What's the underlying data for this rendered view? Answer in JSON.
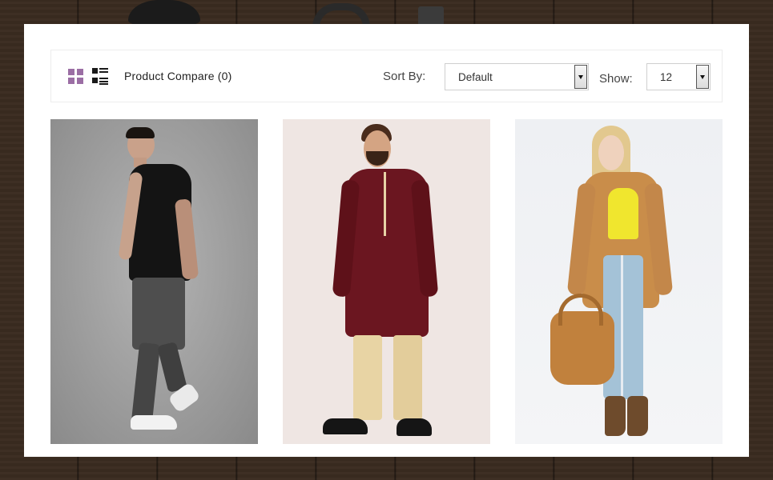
{
  "toolbar": {
    "compare_label": "Product Compare (0)",
    "sort_label": "Sort By:",
    "sort_value": "Default",
    "show_label": "Show:",
    "show_value": "12",
    "grid_icon": "grid-view-icon",
    "list_icon": "list-view-icon"
  },
  "products": [
    {
      "image": "man in black polo and grey jeans"
    },
    {
      "image": "man in maroon kurta and gold pants"
    },
    {
      "image": "woman in tan coat holding brown handbag"
    }
  ],
  "colors": {
    "accent": "#9b6ea4",
    "panel": "#ffffff",
    "background": "#3a2b20"
  }
}
